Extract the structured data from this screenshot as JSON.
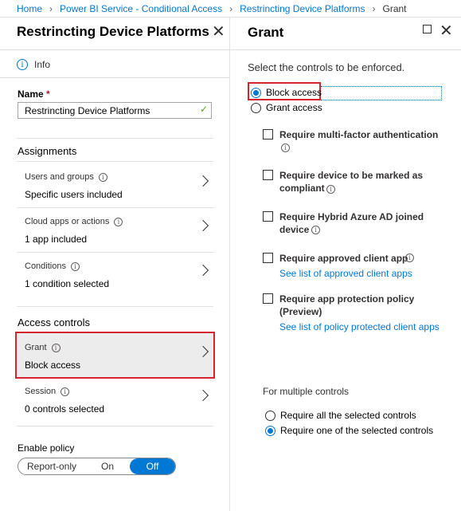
{
  "breadcrumb": {
    "items": [
      "Home",
      "Power BI Service - Conditional Access",
      "Restrincting Device Platforms"
    ],
    "current": "Grant"
  },
  "left_blade": {
    "title": "Restrincting Device Platforms",
    "info_label": "Info",
    "name_label": "Name",
    "name_required": "*",
    "name_value": "Restrincting Device Platforms",
    "assignments_title": "Assignments",
    "assignments": [
      {
        "label": "Users and groups",
        "value": "Specific users included"
      },
      {
        "label": "Cloud apps or actions",
        "value": "1 app included"
      },
      {
        "label": "Conditions",
        "value": "1 condition selected"
      }
    ],
    "access_controls_title": "Access controls",
    "grant": {
      "label": "Grant",
      "value": "Block access"
    },
    "session": {
      "label": "Session",
      "value": "0 controls selected"
    },
    "enable_policy_title": "Enable policy",
    "toggle_options": [
      "Report-only",
      "On",
      "Off"
    ],
    "toggle_selected": "Off"
  },
  "right_blade": {
    "title": "Grant",
    "prompt": "Select the controls to be enforced.",
    "radio_block": "Block access",
    "radio_grant": "Grant access",
    "checkboxes": [
      {
        "line1": "Require multi-factor authentication"
      },
      {
        "line1": "Require device to be marked as",
        "line2": "compliant"
      },
      {
        "line1": "Require Hybrid Azure AD joined",
        "line2": "device"
      },
      {
        "line1": "Require approved client app",
        "link": "See list of approved client apps"
      },
      {
        "line1": "Require app protection policy",
        "line2": "(Preview)",
        "link": "See list of policy protected client apps"
      }
    ],
    "multiple_title": "For multiple controls",
    "multiple_all": "Require all the selected controls",
    "multiple_one": "Require one of the selected controls"
  },
  "colors": {
    "accent": "#0078d4",
    "highlight_border": "#d4252e",
    "selected_bg": "#ececec"
  },
  "icons": [
    "info-icon",
    "close-icon",
    "chevron-right-icon",
    "maximize-icon",
    "checkmark-icon"
  ]
}
